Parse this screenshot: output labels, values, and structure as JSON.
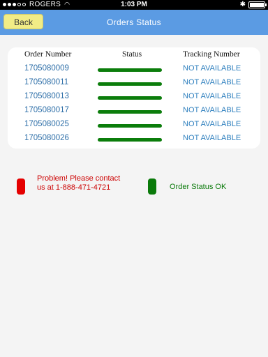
{
  "statusbar": {
    "carrier": "ROGERS",
    "time": "1:03 PM"
  },
  "nav": {
    "back_label": "Back",
    "title": "Orders Status"
  },
  "table": {
    "headers": {
      "order": "Order Number",
      "status": "Status",
      "tracking": "Tracking Number"
    },
    "rows": [
      {
        "order": "1705080009",
        "tracking": "NOT AVAILABLE"
      },
      {
        "order": "1705080011",
        "tracking": "NOT AVAILABLE"
      },
      {
        "order": "1705080013",
        "tracking": "NOT AVAILABLE"
      },
      {
        "order": "1705080017",
        "tracking": "NOT AVAILABLE"
      },
      {
        "order": "1705080025",
        "tracking": "NOT AVAILABLE"
      },
      {
        "order": "1705080026",
        "tracking": "NOT AVAILABLE"
      }
    ]
  },
  "legend": {
    "problem_text": "Problem! Please contact us at 1-888-471-4721",
    "ok_text": "Order Status OK",
    "problem_color": "#e50000",
    "ok_color": "#0a7a0a"
  },
  "colors": {
    "nav": "#5b9be3",
    "back_button": "#f1ec86",
    "status_ok": "#0b7d0b",
    "link": "#2e6fa8"
  }
}
